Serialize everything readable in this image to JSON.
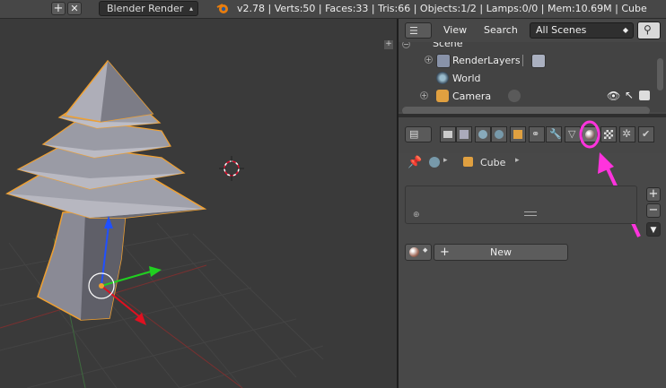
{
  "topbar": {
    "render_engine": "Blender Render",
    "stats": "v2.78 | Verts:50 | Faces:33 | Tris:66 | Objects:1/2 | Lamps:0/0 | Mem:10.69M | Cube"
  },
  "outliner": {
    "menu_view": "View",
    "menu_search": "Search",
    "scene_filter": "All Scenes",
    "items": [
      {
        "label": "Scene"
      },
      {
        "label": "RenderLayers"
      },
      {
        "label": "World"
      },
      {
        "label": "Camera"
      }
    ]
  },
  "properties": {
    "breadcrumb_object": "Cube",
    "new_button": "New"
  },
  "colors": {
    "highlight": "#ff33dd",
    "selection_outline": "#f0a030",
    "axis_x": "#e01020",
    "axis_y": "#20d020",
    "axis_z": "#2050ff"
  }
}
